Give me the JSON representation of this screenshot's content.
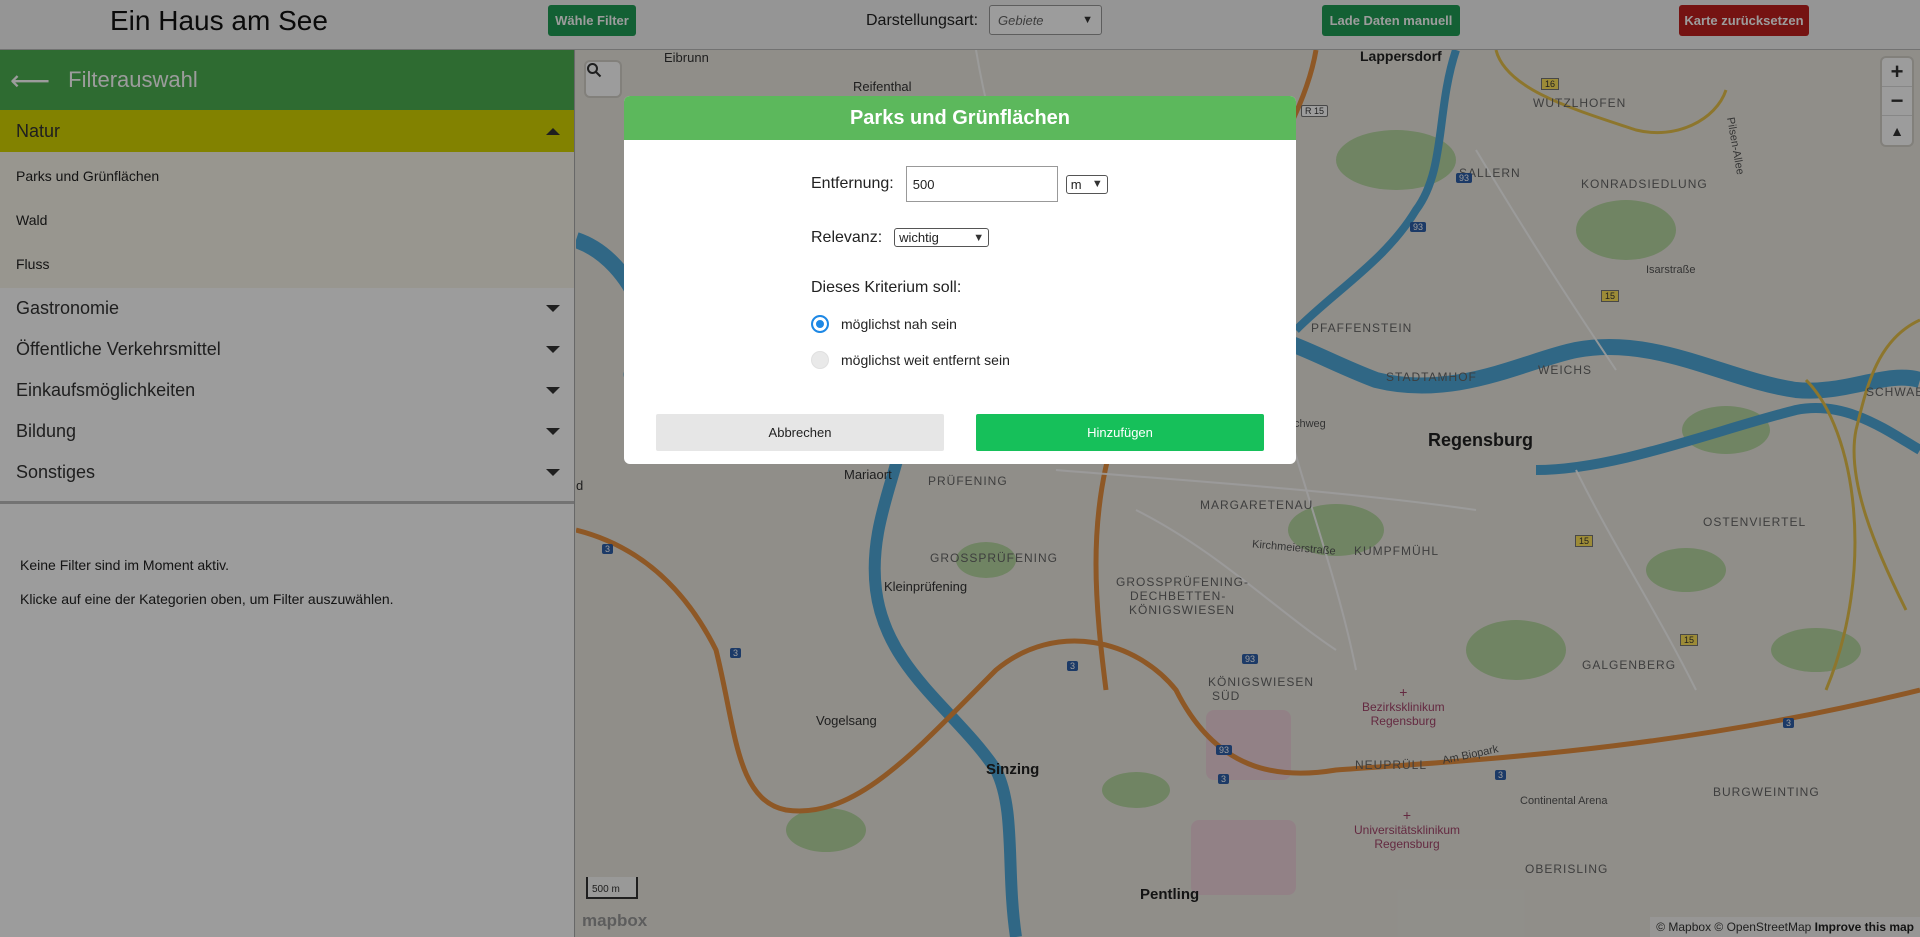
{
  "header": {
    "title": "Ein Haus am See",
    "filter_button": "Wähle Filter",
    "mode_label": "Darstellungsart:",
    "mode_select_value": "Gebiete",
    "load_button": "Lade Daten manuell",
    "reset_button": "Karte zurücksetzen"
  },
  "sidebar": {
    "title": "Filterauswahl",
    "categories": [
      {
        "label": "Natur",
        "open": true,
        "items": [
          "Parks und Grünflächen",
          "Wald",
          "Fluss"
        ]
      },
      {
        "label": "Gastronomie"
      },
      {
        "label": "Öffentliche Verkehrsmittel"
      },
      {
        "label": "Einkaufsmöglichkeiten"
      },
      {
        "label": "Bildung"
      },
      {
        "label": "Sonstiges"
      }
    ],
    "info_line1": "Keine Filter sind im Moment aktiv.",
    "info_line2": "Klicke auf eine der Kategorien oben, um Filter auszuwählen."
  },
  "map": {
    "labels": {
      "eibrunn": "Eibrunn",
      "reifenthal": "Reifenthal",
      "lappersdorf": "Lappersdorf",
      "wutzlhofen": "WUTZLHOFEN",
      "sallern": "SALLERN",
      "konradsiedlung": "KONRADSIEDLUNG",
      "isarstrasse": "Isarstraße",
      "pfaffenstein": "PFAFFENSTEIN",
      "stadtamhof": "STADTAMHOF",
      "weichs": "WEICHS",
      "schwabelweis": "SCHWABELW",
      "regensburg": "Regensburg",
      "mariaort": "Mariaort",
      "pruefening": "PRÜFENING",
      "margaretenau": "MARGARETENAU",
      "kirchmeierstrasse": "Kirchmeierstraße",
      "ostenviertel": "OSTENVIERTEL",
      "grosspruefening": "GROSSPRÜFENING",
      "kleinpruefening": "Kleinprüfening",
      "gpd_line1": "GROSSPRÜFENING-",
      "gpd_line2": "DECHBETTEN-",
      "gpd_line3": "KÖNIGSWIESEN",
      "kumpfmuehl": "KUMPFMÜHL",
      "galgenberg": "GALGENBERG",
      "kw_line1": "KÖNIGSWIESEN",
      "kw_line2": "SÜD",
      "bezirks_line1": "Bezirksklinikum",
      "bezirks_line2": "Regensburg",
      "vogelsang": "Vogelsang",
      "sinzing": "Sinzing",
      "neupruell": "NEUPRÜLL",
      "ambiopark": "Am Biopark",
      "continental": "Continental Arena",
      "burgweinting": "BURGWEINTING",
      "uni_line1": "Universitätsklinikum",
      "uni_line2": "Regensburg",
      "oberisling": "OBERISLING",
      "pentling": "Pentling",
      "pilsen": "Pilsen-Allee",
      "left_d": "d",
      "schweg": "chweg"
    },
    "shields": {
      "r15": "R 15",
      "s16": "16",
      "a93a": "93",
      "a93b": "93",
      "s15a": "15",
      "s15b": "15",
      "s15c": "15",
      "a3a": "3",
      "a3b": "3",
      "a3c": "3",
      "a3d": "3",
      "a3e": "3",
      "a3f": "3",
      "a93c": "93",
      "a93d": "93"
    },
    "scale_label": "500 m",
    "logo": "mapbox",
    "attribution": "© Mapbox © OpenStreetMap",
    "improve": "Improve this map",
    "zoom_in": "+",
    "zoom_out": "−"
  },
  "modal": {
    "title": "Parks und Grünflächen",
    "distance_label": "Entfernung:",
    "distance_value": "500",
    "unit_value": "m",
    "relevance_label": "Relevanz:",
    "relevance_value": "wichtig",
    "criterion_label": "Dieses Kriterium soll:",
    "option_near": "möglichst nah sein",
    "option_far": "möglichst weit entfernt sein",
    "cancel": "Abbrechen",
    "add": "Hinzufügen"
  },
  "colors": {
    "green_button": "#1f9d55",
    "red_button": "#c0201e",
    "sidebar_header": "#4caf50",
    "category_open": "#d4d400",
    "modal_header": "#5cb85c",
    "add_button": "#16c05a",
    "river": "#4fa9d9",
    "motorway": "#e8903e",
    "park": "#b7d8a2"
  }
}
